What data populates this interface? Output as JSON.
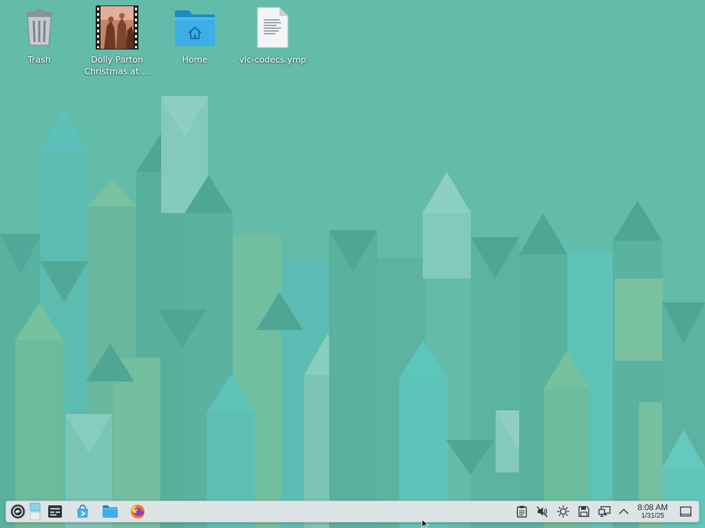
{
  "desktop": {
    "icons": [
      {
        "label": "Trash",
        "icon": "trash-icon"
      },
      {
        "label_line1": "Dolly Parton",
        "label_line2": "Christmas at ...",
        "icon": "video-thumbnail-icon"
      },
      {
        "label": "Home",
        "icon": "home-folder-icon"
      },
      {
        "label": "vlc-codecs.ymp",
        "icon": "text-file-icon"
      }
    ]
  },
  "taskbar": {
    "launchers": [
      "application-menu-icon",
      "desktop-pager-icon",
      "terminal-icon",
      "discover-store-icon",
      "file-manager-icon",
      "firefox-icon"
    ],
    "tray": [
      "clipboard-icon",
      "volume-muted-icon",
      "brightness-icon",
      "disks-icon",
      "network-icon",
      "show-hidden-icon"
    ],
    "clock": {
      "time": "8:08 AM",
      "date": "1/31/25"
    }
  },
  "colors": {
    "wallpaper_base": "#63bcaa",
    "panel_bg": "#dde4e5",
    "accent_blue": "#3daee9"
  }
}
